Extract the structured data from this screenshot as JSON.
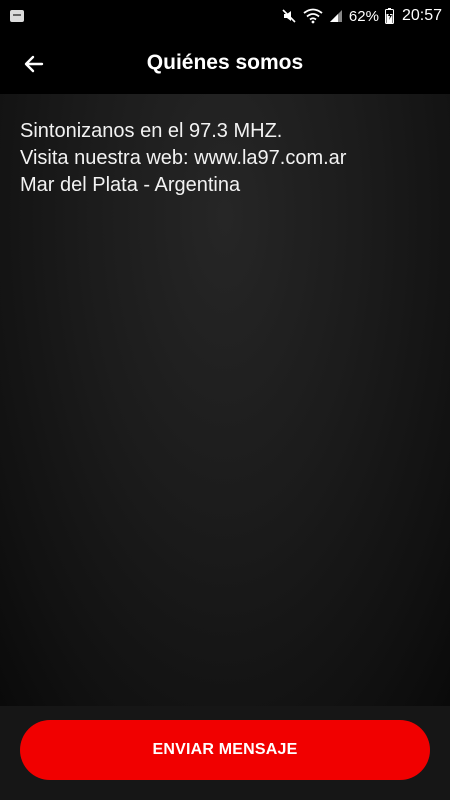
{
  "status_bar": {
    "battery": "62%",
    "time": "20:57",
    "icons": [
      "notification-icon",
      "mute-icon",
      "wifi-icon",
      "signal-icon",
      "battery-icon"
    ]
  },
  "app_bar": {
    "title": "Quiénes somos",
    "back_icon": "arrow-left-icon"
  },
  "about": {
    "lines": [
      "Sintonizanos en el 97.3 MHZ.",
      "Visita nuestra web: www.la97.com.ar",
      "Mar del Plata - Argentina"
    ]
  },
  "footer": {
    "send_label": "ENVIAR MENSAJE"
  },
  "colors": {
    "accent": "#f10000",
    "background": "#1b1b1b",
    "bar": "#000000"
  }
}
